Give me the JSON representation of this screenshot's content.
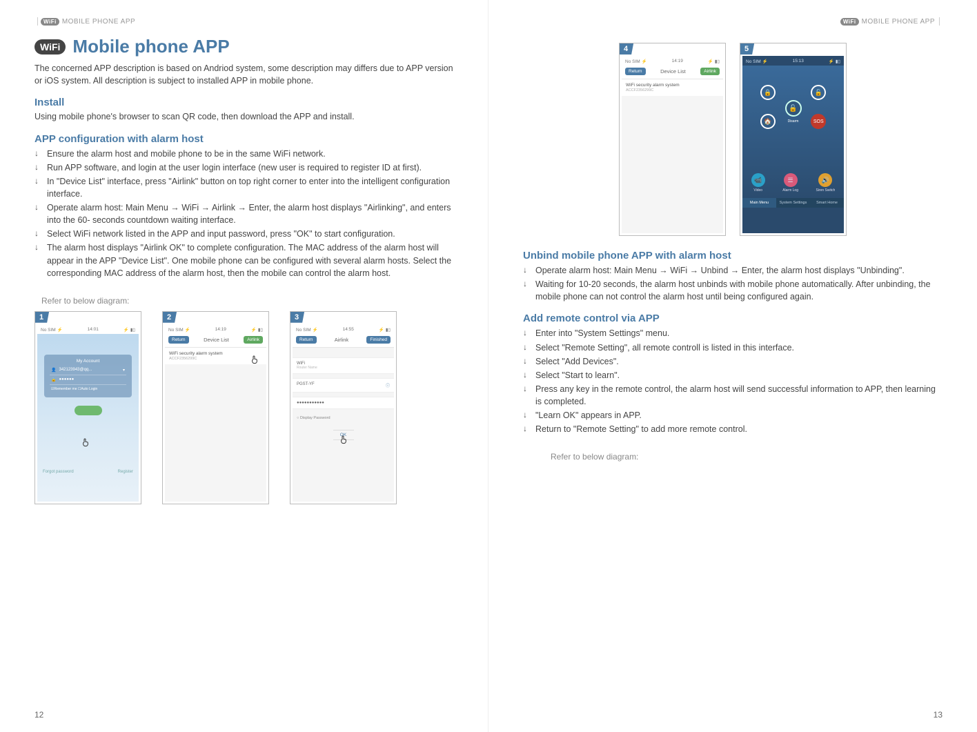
{
  "header_label": "MOBILE PHONE APP",
  "wifi_badge": "WiFi",
  "title": "Mobile phone APP",
  "intro": "The concerned APP description is based on Andriod system, some description may differs due to APP version or iOS system. All description is subject to installed APP in mobile phone.",
  "install_heading": "Install",
  "install_text": "Using mobile phone's browser to scan QR code, then download the APP and install.",
  "config_heading": "APP configuration with alarm host",
  "config_items": [
    "Ensure the alarm host and mobile phone to be in the same WiFi network.",
    "Run APP software, and login at the user login interface (new user is required to register ID at first).",
    "In \"Device List\" interface, press \"Airlink\" button on top right corner to enter into the intelligent configuration interface.",
    "Operate alarm host: Main Menu → WiFi → Airlink → Enter, the alarm host displays \"Airlinking\", and enters into the 60- seconds countdown waiting interface.",
    "Select WiFi network listed in the APP and input password,  press \"OK\" to start configuration.",
    "The alarm host displays \"Airlink OK\"   to complete configuration. The MAC address of the alarm host will appear in the APP \"Device List\". One mobile phone can be configured with several alarm hosts. Select the corresponding MAC address of the alarm host, then the mobile can control the alarm host."
  ],
  "refer_text": "Refer to below diagram:",
  "shots_left": {
    "s1": {
      "num": "1",
      "status_left": "No SIM ⚡",
      "time": "14:01",
      "acct_title": "My Account",
      "user_row": "342123943@qq...",
      "pass_row": "●●●●●●",
      "check_row": "☑Remember me   ☐Auto Login",
      "forgot": "Forgot password",
      "register": "Register"
    },
    "s2": {
      "num": "2",
      "status_left": "No SIM ⚡",
      "time": "14:19",
      "return": "Return",
      "title": "Device List",
      "airlink": "Airlink",
      "item_name": "WiFi security alarm system",
      "item_mac": "ACCF2356299C"
    },
    "s3": {
      "num": "3",
      "status_left": "No SIM ⚡",
      "time": "14:55",
      "return": "Return",
      "title": "Airlink",
      "finished": "Finished",
      "wifi_label": "WiFi",
      "wifi_hint": "Router Name",
      "ssid": "PGST-YF",
      "pwd": "●●●●●●●●●●●",
      "display_pwd": "Display Password",
      "ok": "OK"
    }
  },
  "shots_right": {
    "s4": {
      "num": "4",
      "status_left": "No SIM ⚡",
      "time": "14:19",
      "return": "Return",
      "title": "Device List",
      "airlink": "Airlink",
      "item_name": "WiFi security alarm system",
      "item_mac": "ACCF2356299C"
    },
    "s5": {
      "num": "5",
      "status_left": "No SIM ⚡",
      "time": "15:13",
      "disarm": "Disarm",
      "sos": "SOS",
      "video": "Video",
      "alarmlog": "Alarm Log",
      "siren": "Siren Switch",
      "tab_main": "Main Menu",
      "tab_sys": "System Settings",
      "tab_smart": "Smart Home"
    }
  },
  "unbind_heading": "Unbind mobile phone APP with alarm host",
  "unbind_items": [
    "Operate alarm host: Main Menu → WiFi → Unbind → Enter, the alarm host displays \"Unbinding\".",
    "Waiting for 10-20 seconds, the alarm host unbinds with mobile phone automatically. After unbinding, the mobile phone can not control the alarm host until being configured again."
  ],
  "addremote_heading": "Add remote control via APP",
  "addremote_items": [
    "Enter into \"System Settings\" menu.",
    "Select \"Remote Setting\", all remote controll is listed in this interface.",
    "Select \"Add Devices\".",
    "Select \"Start to learn\".",
    "Press any key in the remote control, the alarm host will send successful information to APP, then learning is completed.",
    "\"Learn OK\" appears in APP.",
    "Return to \"Remote Setting\" to add more remote control."
  ],
  "page_left_num": "12",
  "page_right_num": "13"
}
